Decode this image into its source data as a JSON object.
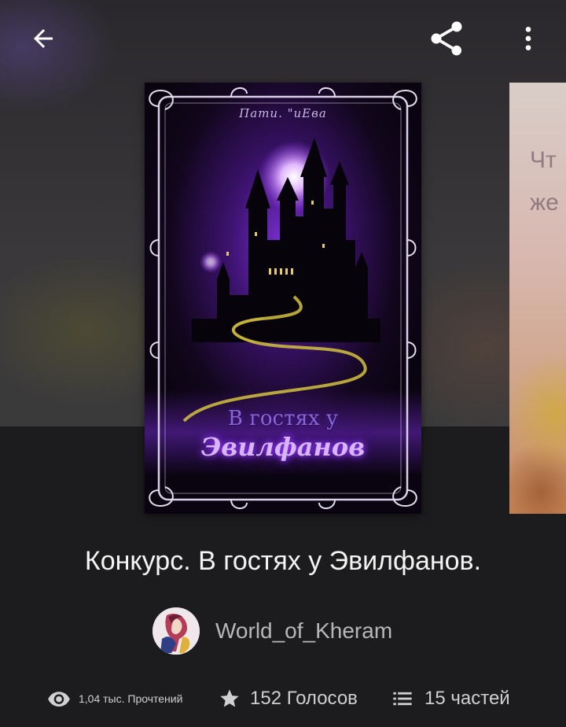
{
  "icons": {
    "back": "arrow-left-icon",
    "share": "share-icon",
    "more": "more-vertical-icon",
    "reads": "eye-icon",
    "votes": "star-icon",
    "parts": "list-icon"
  },
  "cover": {
    "author_text": "Пати. \"иЕва",
    "title_line1": "В гостях у",
    "title_line2": "Эвилфанов"
  },
  "next_cover": {
    "line1": "Чт",
    "line2": "же"
  },
  "book": {
    "title": "Конкурс. В гостях у Эвилфанов."
  },
  "author": {
    "name": "World_of_Kheram"
  },
  "stats": {
    "reads": "1,04 тыс. Прочтений",
    "votes": "152 Голосов",
    "parts": "15 частей"
  },
  "colors": {
    "background": "#1c1b1d",
    "hero": "#3a383a",
    "cover_glow": "#9b3cff"
  }
}
